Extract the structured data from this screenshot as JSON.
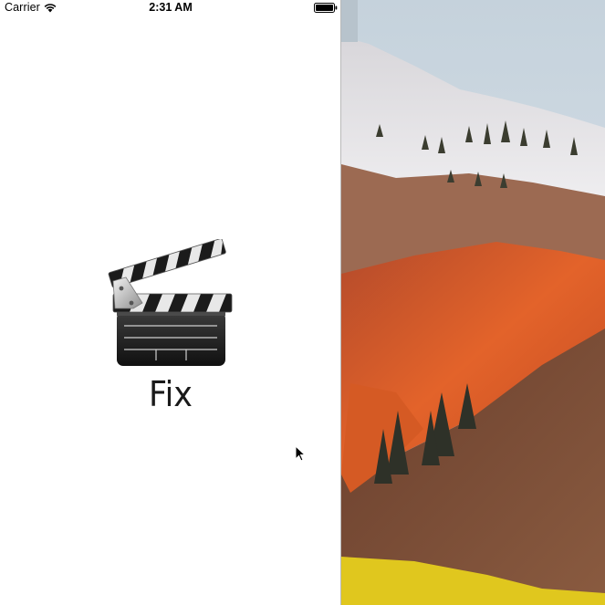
{
  "status_bar": {
    "carrier": "Carrier",
    "time": "2:31 AM",
    "wifi_icon": "wifi-icon",
    "battery_icon": "battery-icon"
  },
  "app": {
    "title": "Fix",
    "logo_icon": "clapperboard-icon"
  },
  "desktop": {
    "wallpaper": "mountain-wallpaper",
    "cursor_icon": "pointer-cursor-icon"
  },
  "colors": {
    "screen_bg": "#ffffff",
    "text": "#1a1a1a",
    "sky": "#c9d6e0",
    "snow": "#e7e6e8",
    "orange": "#e0622a",
    "brown": "#7a4a34",
    "yellow": "#e6cc1e"
  }
}
